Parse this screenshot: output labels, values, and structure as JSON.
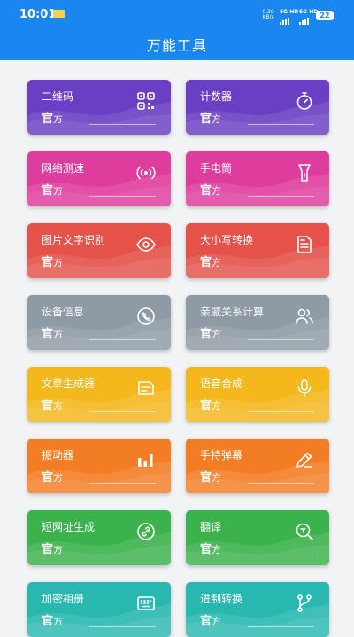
{
  "status_bar": {
    "time": "10:01",
    "speed": "0.30 KB/s",
    "network1": "5G HD",
    "network2": "5G HD",
    "battery": "22"
  },
  "header": {
    "title": "万能工具"
  },
  "cards": [
    {
      "name": "二维码",
      "official_bold": "官",
      "official_rest": "方",
      "color": "#6a3fc3",
      "icon": "qrcode-icon"
    },
    {
      "name": "计数器",
      "official_bold": "官",
      "official_rest": "方",
      "color": "#6a3fc3",
      "icon": "stopwatch-icon"
    },
    {
      "name": "网络测速",
      "official_bold": "官",
      "official_rest": "方",
      "color": "#df3d9e",
      "icon": "signal-icon"
    },
    {
      "name": "手电筒",
      "official_bold": "官",
      "official_rest": "方",
      "color": "#df3d9e",
      "icon": "flashlight-icon"
    },
    {
      "name": "图片文字识别",
      "official_bold": "官",
      "official_rest": "方",
      "color": "#e4524a",
      "icon": "eye-icon"
    },
    {
      "name": "大小写转换",
      "official_bold": "官",
      "official_rest": "方",
      "color": "#e4524a",
      "icon": "document-icon"
    },
    {
      "name": "设备信息",
      "official_bold": "官",
      "official_rest": "方",
      "color": "#8e9aa4",
      "icon": "phone-icon"
    },
    {
      "name": "亲戚关系计算",
      "official_bold": "官",
      "official_rest": "方",
      "color": "#8e9aa4",
      "icon": "people-icon"
    },
    {
      "name": "文章生成器",
      "official_bold": "官",
      "official_rest": "方",
      "color": "#f4b71c",
      "icon": "article-icon"
    },
    {
      "name": "语音合成",
      "official_bold": "官",
      "official_rest": "方",
      "color": "#f4b71c",
      "icon": "microphone-icon"
    },
    {
      "name": "振动器",
      "official_bold": "官",
      "official_rest": "方",
      "color": "#f37d24",
      "icon": "bar-chart-icon"
    },
    {
      "name": "手持弹幕",
      "official_bold": "官",
      "official_rest": "方",
      "color": "#f37d24",
      "icon": "pencil-icon"
    },
    {
      "name": "短网址生成",
      "official_bold": "官",
      "official_rest": "方",
      "color": "#3bb24b",
      "icon": "link-icon"
    },
    {
      "name": "翻译",
      "official_bold": "官",
      "official_rest": "方",
      "color": "#3bb24b",
      "icon": "translate-icon"
    },
    {
      "name": "加密相册",
      "official_bold": "官",
      "official_rest": "方",
      "color": "#29b8b0",
      "icon": "keyboard-icon"
    },
    {
      "name": "进制转换",
      "official_bold": "官",
      "official_rest": "方",
      "color": "#29b8b0",
      "icon": "branch-icon"
    }
  ]
}
